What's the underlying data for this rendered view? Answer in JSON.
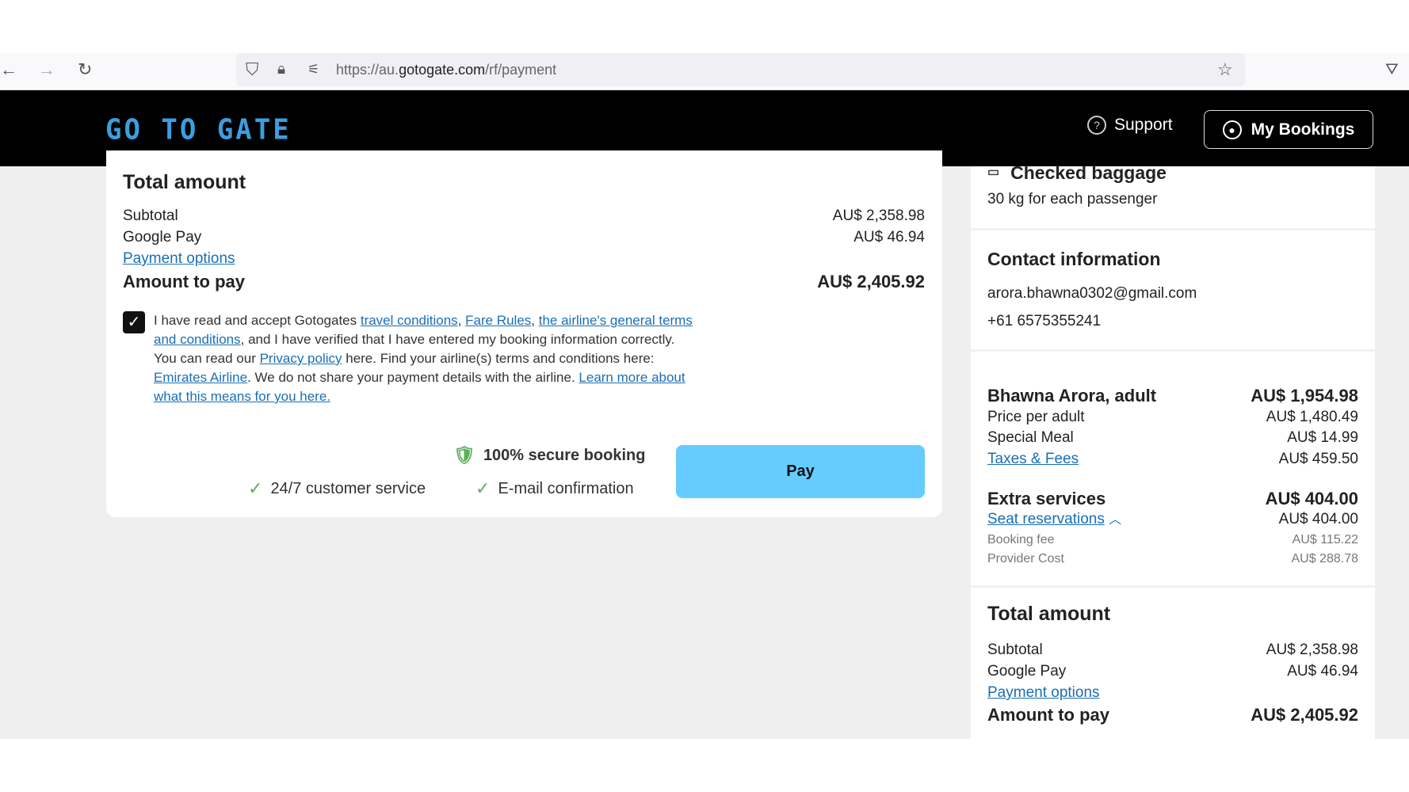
{
  "browser": {
    "url_prefix": "https://au.",
    "url_domain": "gotogate.com",
    "url_path": "/rf/payment"
  },
  "header": {
    "logo": "GOTOGATE",
    "support": "Support",
    "my_bookings": "My Bookings"
  },
  "payment_card": {
    "title": "Total amount",
    "subtotal_label": "Subtotal",
    "subtotal": "AU$ 2,358.98",
    "gpay_label": "Google Pay",
    "gpay": "AU$ 46.94",
    "payment_options": "Payment options",
    "amount_label": "Amount to pay",
    "amount": "AU$ 2,405.92",
    "terms": {
      "t1": "I have read and accept Gotogates ",
      "l1": "travel conditions",
      "t2": ", ",
      "l2": "Fare Rules",
      "t3": ", ",
      "l3": "the airline's general terms and conditions",
      "t4": ", and I have verified that I have entered my booking information correctly.",
      "t5": "You can read our ",
      "l4": "Privacy policy",
      "t6": " here. Find your airline(s) terms and conditions here: ",
      "l5": "Emirates Airline",
      "t7": ". We do not share your payment details with the airline. ",
      "l6": "Learn more about what this means for you here."
    },
    "terms_checked": true,
    "secure": "100% secure booking",
    "customer_service": "24/7 customer service",
    "email_confirmation": "E-mail confirmation",
    "pay": "Pay"
  },
  "summary": {
    "baggage_title": "Checked baggage",
    "baggage_desc": "30 kg for each passenger",
    "contact_title": "Contact information",
    "email": "arora.bhawna0302@gmail.com",
    "phone": "+61 6575355241",
    "passenger": "Bhawna Arora, adult",
    "passenger_total": "AU$ 1,954.98",
    "items": [
      {
        "label": "Price per adult",
        "value": "AU$ 1,480.49"
      },
      {
        "label": "Special Meal",
        "value": "AU$ 14.99"
      },
      {
        "label": "Taxes & Fees",
        "value": "AU$ 459.50"
      }
    ],
    "extra_title": "Extra services",
    "extra_total": "AU$ 404.00",
    "seat_label": "Seat reservations",
    "seat_value": "AU$ 404.00",
    "booking_fee_label": "Booking fee",
    "booking_fee": "AU$ 115.22",
    "provider_label": "Provider Cost",
    "provider": "AU$ 288.78",
    "total_title": "Total amount",
    "subtotal_label": "Subtotal",
    "subtotal": "AU$ 2,358.98",
    "gpay_label": "Google Pay",
    "gpay": "AU$ 46.94",
    "payment_options": "Payment options",
    "amount_label": "Amount to pay",
    "amount": "AU$ 2,405.92"
  }
}
